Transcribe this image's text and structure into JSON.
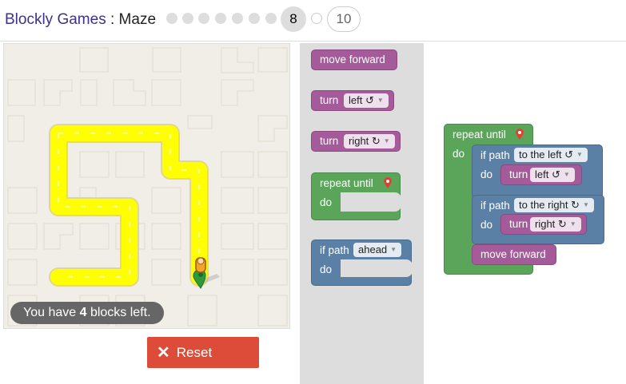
{
  "header": {
    "app_name": "Blockly Games",
    "separator": " : ",
    "game_name": "Maze",
    "current_level": "8",
    "last_level": "10"
  },
  "maze": {
    "capacity_prefix": "You have ",
    "blocks_left": "4",
    "capacity_suffix": " blocks left."
  },
  "reset": {
    "label": "Reset"
  },
  "toolbox": {
    "move_forward": "move forward",
    "turn_label": "turn",
    "turn_left_option": "left ↺",
    "turn_right_option": "right ↻",
    "repeat_until": "repeat until",
    "do": "do",
    "if_path": "if path",
    "if_path_option": "ahead"
  },
  "workspace": {
    "repeat_until": "repeat until",
    "do": "do",
    "if1_label": "if path",
    "if1_option": "to the left ↺",
    "if1_do": "do",
    "turn1_label": "turn",
    "turn1_option": "left ↺",
    "if2_label": "if path",
    "if2_option": "to the right ↻",
    "if2_do": "do",
    "turn2_label": "turn",
    "turn2_option": "right ↻",
    "move_forward": "move forward"
  },
  "colors": {
    "motion_block": "#a55b99",
    "loop_block": "#5ba55b",
    "logic_block": "#5b80a5",
    "path": "#ffff00",
    "reset_button": "#dd4b39",
    "app_title": "#3e3286"
  }
}
